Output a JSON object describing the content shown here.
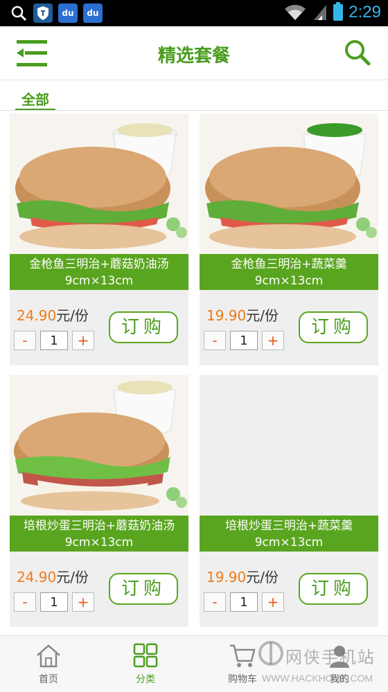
{
  "status_bar": {
    "time": "2:29",
    "baidu_label": "du"
  },
  "header": {
    "title": "精选套餐"
  },
  "category": {
    "active_tab": "全部"
  },
  "products": [
    {
      "name": "金枪鱼三明治+蘑菇奶油汤",
      "size": "9cm×13cm",
      "price": "24.90",
      "unit": "元/份",
      "qty": "1",
      "order_label": "订购",
      "image": "tuna-sandwich-mushroom-soup"
    },
    {
      "name": "金枪鱼三明治+蔬菜羹",
      "size": "9cm×13cm",
      "price": "19.90",
      "unit": "元/份",
      "qty": "1",
      "order_label": "订购",
      "image": "tuna-sandwich-vegetable-soup"
    },
    {
      "name": "培根炒蛋三明治+蘑菇奶油汤",
      "size": "9cm×13cm",
      "price": "24.90",
      "unit": "元/份",
      "qty": "1",
      "order_label": "订购",
      "image": "bacon-egg-sandwich-mushroom-soup"
    },
    {
      "name": "培根炒蛋三明治+蔬菜羹",
      "size": "9cm×13cm",
      "price": "19.90",
      "unit": "元/份",
      "qty": "1",
      "order_label": "订购",
      "image": ""
    }
  ],
  "stepper": {
    "minus": "-",
    "plus": "+"
  },
  "bottom_nav": [
    {
      "label": "首页",
      "icon": "home-icon"
    },
    {
      "label": "分类",
      "icon": "grid-icon",
      "active": true
    },
    {
      "label": "购物车",
      "icon": "cart-icon"
    },
    {
      "label": "我的",
      "icon": "user-icon"
    }
  ],
  "watermark": {
    "main": "网侠手机站",
    "sub": "WWW.HACKHOME.COM"
  },
  "colors": {
    "brand_green": "#5aa51f",
    "price_orange": "#f07a16",
    "status_blue": "#35b5e5"
  }
}
